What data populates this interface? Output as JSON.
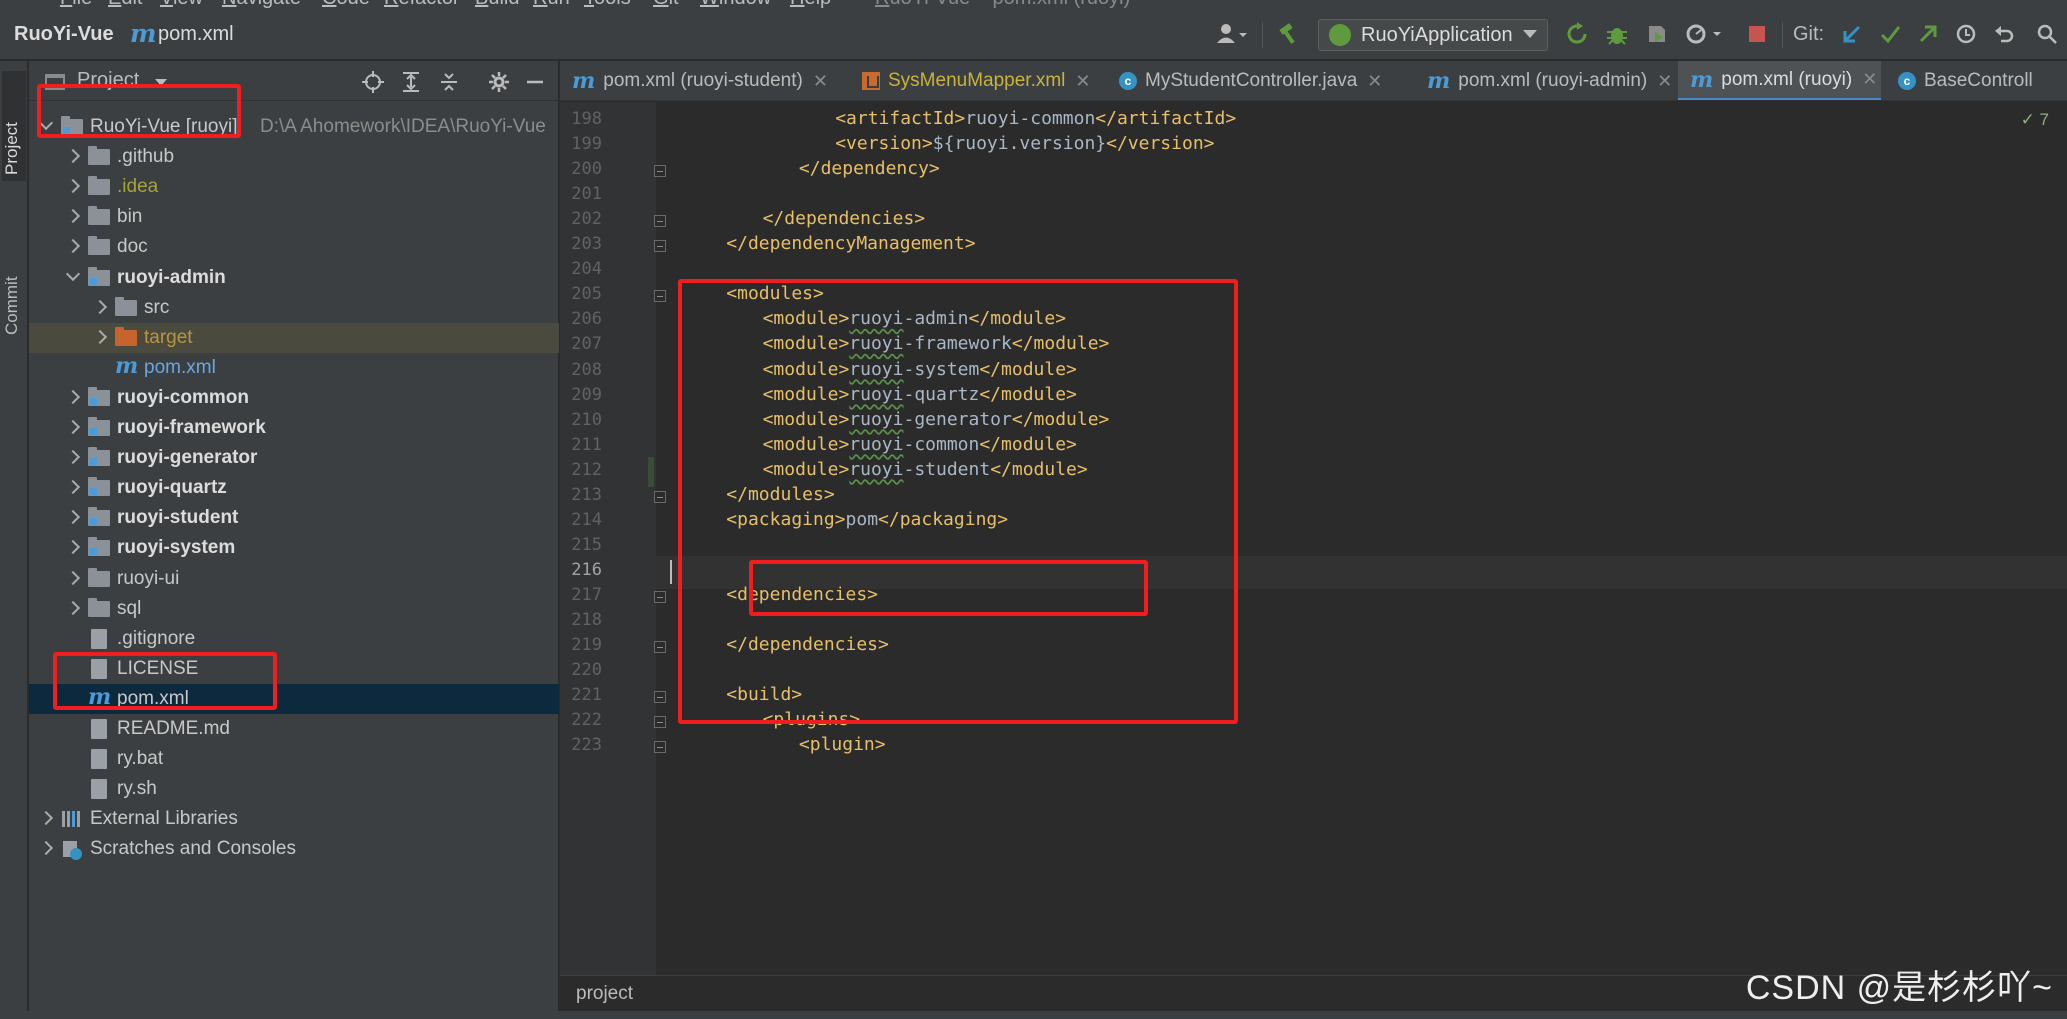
{
  "menu": [
    "File",
    "Edit",
    "View",
    "Navigate",
    "Code",
    "Refactor",
    "Build",
    "Run",
    "Tools",
    "Git",
    "Window",
    "Help"
  ],
  "window_title": "RuoYi-Vue – pom.xml (ruoyi)",
  "navbar": {
    "project": "RuoYi-Vue",
    "separator": "〉",
    "file": "pom.xml",
    "run_config": "RuoYiApplication",
    "git_label": "Git:"
  },
  "toolstrip": {
    "project_tab": "Project",
    "commit_tab": "Commit"
  },
  "project_panel": {
    "title": "Project",
    "tree": [
      {
        "label": "RuoYi-Vue [ruoyi]",
        "path": "D:\\A Ahomework\\IDEA\\RuoYi-Vue",
        "depth": 0,
        "expanded": true,
        "kind": "module-root",
        "style": "normal"
      },
      {
        "label": ".github",
        "depth": 1,
        "expanded": false,
        "kind": "folder",
        "style": "normal"
      },
      {
        "label": ".idea",
        "depth": 1,
        "expanded": false,
        "kind": "folder",
        "style": "olive"
      },
      {
        "label": "bin",
        "depth": 1,
        "expanded": false,
        "kind": "folder",
        "style": "normal"
      },
      {
        "label": "doc",
        "depth": 1,
        "expanded": false,
        "kind": "folder",
        "style": "normal"
      },
      {
        "label": "ruoyi-admin",
        "depth": 1,
        "expanded": true,
        "kind": "module",
        "style": "bold"
      },
      {
        "label": "src",
        "depth": 2,
        "expanded": false,
        "kind": "folder",
        "style": "normal"
      },
      {
        "label": "target",
        "depth": 2,
        "expanded": false,
        "kind": "folder-excluded",
        "style": "gold"
      },
      {
        "label": "pom.xml",
        "depth": 2,
        "kind": "maven",
        "style": "blue"
      },
      {
        "label": "ruoyi-common",
        "depth": 1,
        "expanded": false,
        "kind": "module",
        "style": "bold"
      },
      {
        "label": "ruoyi-framework",
        "depth": 1,
        "expanded": false,
        "kind": "module",
        "style": "bold"
      },
      {
        "label": "ruoyi-generator",
        "depth": 1,
        "expanded": false,
        "kind": "module",
        "style": "bold"
      },
      {
        "label": "ruoyi-quartz",
        "depth": 1,
        "expanded": false,
        "kind": "module",
        "style": "bold"
      },
      {
        "label": "ruoyi-student",
        "depth": 1,
        "expanded": false,
        "kind": "module",
        "style": "bold"
      },
      {
        "label": "ruoyi-system",
        "depth": 1,
        "expanded": false,
        "kind": "module",
        "style": "bold"
      },
      {
        "label": "ruoyi-ui",
        "depth": 1,
        "expanded": false,
        "kind": "folder",
        "style": "normal"
      },
      {
        "label": "sql",
        "depth": 1,
        "expanded": false,
        "kind": "folder",
        "style": "normal"
      },
      {
        "label": ".gitignore",
        "depth": 1,
        "kind": "file",
        "style": "normal"
      },
      {
        "label": "LICENSE",
        "depth": 1,
        "kind": "file",
        "style": "normal"
      },
      {
        "label": "pom.xml",
        "depth": 1,
        "kind": "maven",
        "style": "normal"
      },
      {
        "label": "README.md",
        "depth": 1,
        "kind": "file",
        "style": "normal"
      },
      {
        "label": "ry.bat",
        "depth": 1,
        "kind": "file",
        "style": "normal"
      },
      {
        "label": "ry.sh",
        "depth": 1,
        "kind": "file",
        "style": "normal"
      },
      {
        "label": "External Libraries",
        "depth": 0,
        "expanded": false,
        "kind": "libraries",
        "style": "normal"
      },
      {
        "label": "Scratches and Consoles",
        "depth": 0,
        "expanded": false,
        "kind": "scratches",
        "style": "normal"
      }
    ]
  },
  "tabs": [
    {
      "label": "pom.xml (ruoyi-student)",
      "icon": "maven-icon",
      "active": false
    },
    {
      "label": "SysMenuMapper.xml",
      "icon": "xml-icon",
      "active": false
    },
    {
      "label": "MyStudentController.java",
      "icon": "class-icon",
      "active": false
    },
    {
      "label": "pom.xml (ruoyi-admin)",
      "icon": "maven-icon",
      "active": false
    },
    {
      "label": "pom.xml (ruoyi)",
      "icon": "maven-icon",
      "active": true
    },
    {
      "label": "BaseControll",
      "icon": "class-icon",
      "active": false
    }
  ],
  "editor": {
    "inspection_count": "7",
    "current_line": "216",
    "lines": [
      {
        "n": "198",
        "indent": 4,
        "parts": [
          [
            "tag",
            "<artifactId>"
          ],
          [
            "txt",
            "ruoyi-common"
          ],
          [
            "tag",
            "</artifactId>"
          ]
        ]
      },
      {
        "n": "199",
        "indent": 4,
        "parts": [
          [
            "tag",
            "<version>"
          ],
          [
            "txt",
            "${ruoyi.version}"
          ],
          [
            "tag",
            "</version>"
          ]
        ]
      },
      {
        "n": "200",
        "indent": 3,
        "parts": [
          [
            "tag",
            "</dependency>"
          ]
        ]
      },
      {
        "n": "201",
        "indent": 0,
        "parts": []
      },
      {
        "n": "202",
        "indent": 2,
        "parts": [
          [
            "tag",
            "</dependencies>"
          ]
        ]
      },
      {
        "n": "203",
        "indent": 1,
        "parts": [
          [
            "tag",
            "</dependencyManagement>"
          ]
        ]
      },
      {
        "n": "204",
        "indent": 0,
        "parts": []
      },
      {
        "n": "205",
        "indent": 1,
        "parts": [
          [
            "tag",
            "<modules>"
          ]
        ]
      },
      {
        "n": "206",
        "indent": 2,
        "parts": [
          [
            "tag",
            "<module>"
          ],
          [
            "wavy",
            "ruoyi"
          ],
          [
            "txt",
            "-admin"
          ],
          [
            "tag",
            "</module>"
          ]
        ]
      },
      {
        "n": "207",
        "indent": 2,
        "parts": [
          [
            "tag",
            "<module>"
          ],
          [
            "wavy",
            "ruoyi"
          ],
          [
            "txt",
            "-framework"
          ],
          [
            "tag",
            "</module>"
          ]
        ]
      },
      {
        "n": "208",
        "indent": 2,
        "parts": [
          [
            "tag",
            "<module>"
          ],
          [
            "wavy",
            "ruoyi"
          ],
          [
            "txt",
            "-system"
          ],
          [
            "tag",
            "</module>"
          ]
        ]
      },
      {
        "n": "209",
        "indent": 2,
        "parts": [
          [
            "tag",
            "<module>"
          ],
          [
            "wavy",
            "ruoyi"
          ],
          [
            "txt",
            "-quartz"
          ],
          [
            "tag",
            "</module>"
          ]
        ]
      },
      {
        "n": "210",
        "indent": 2,
        "parts": [
          [
            "tag",
            "<module>"
          ],
          [
            "wavy",
            "ruoyi"
          ],
          [
            "txt",
            "-generator"
          ],
          [
            "tag",
            "</module>"
          ]
        ]
      },
      {
        "n": "211",
        "indent": 2,
        "parts": [
          [
            "tag",
            "<module>"
          ],
          [
            "wavy",
            "ruoyi"
          ],
          [
            "txt",
            "-common"
          ],
          [
            "tag",
            "</module>"
          ]
        ]
      },
      {
        "n": "212",
        "indent": 2,
        "parts": [
          [
            "tag",
            "<module>"
          ],
          [
            "wavy",
            "ruoyi"
          ],
          [
            "txt",
            "-student"
          ],
          [
            "tag",
            "</module>"
          ]
        ]
      },
      {
        "n": "213",
        "indent": 1,
        "parts": [
          [
            "tag",
            "</modules>"
          ]
        ]
      },
      {
        "n": "214",
        "indent": 1,
        "parts": [
          [
            "tag",
            "<packaging>"
          ],
          [
            "txt",
            "pom"
          ],
          [
            "tag",
            "</packaging>"
          ]
        ]
      },
      {
        "n": "215",
        "indent": 0,
        "parts": []
      },
      {
        "n": "216",
        "indent": 0,
        "parts": []
      },
      {
        "n": "217",
        "indent": 1,
        "parts": [
          [
            "tag",
            "<dependencies>"
          ]
        ]
      },
      {
        "n": "218",
        "indent": 0,
        "parts": []
      },
      {
        "n": "219",
        "indent": 1,
        "parts": [
          [
            "tag",
            "</dependencies>"
          ]
        ]
      },
      {
        "n": "220",
        "indent": 0,
        "parts": []
      },
      {
        "n": "221",
        "indent": 1,
        "parts": [
          [
            "tag",
            "<build>"
          ]
        ]
      },
      {
        "n": "222",
        "indent": 2,
        "parts": [
          [
            "tag",
            "<plugins>"
          ]
        ]
      },
      {
        "n": "223",
        "indent": 3,
        "parts": [
          [
            "tag",
            "<plugin>"
          ]
        ]
      }
    ],
    "fold_lines": [
      "200",
      "202",
      "203",
      "205",
      "213",
      "217",
      "219",
      "221",
      "222",
      "223"
    ]
  },
  "bottom_breadcrumb": "project",
  "watermark": "CSDN @是杉杉吖~",
  "colors": {
    "annotation_red": "#f01e1e",
    "tag_yellow": "#e8bf6a",
    "selection_blue": "#0d293e",
    "accent_blue": "#4a88c7"
  }
}
